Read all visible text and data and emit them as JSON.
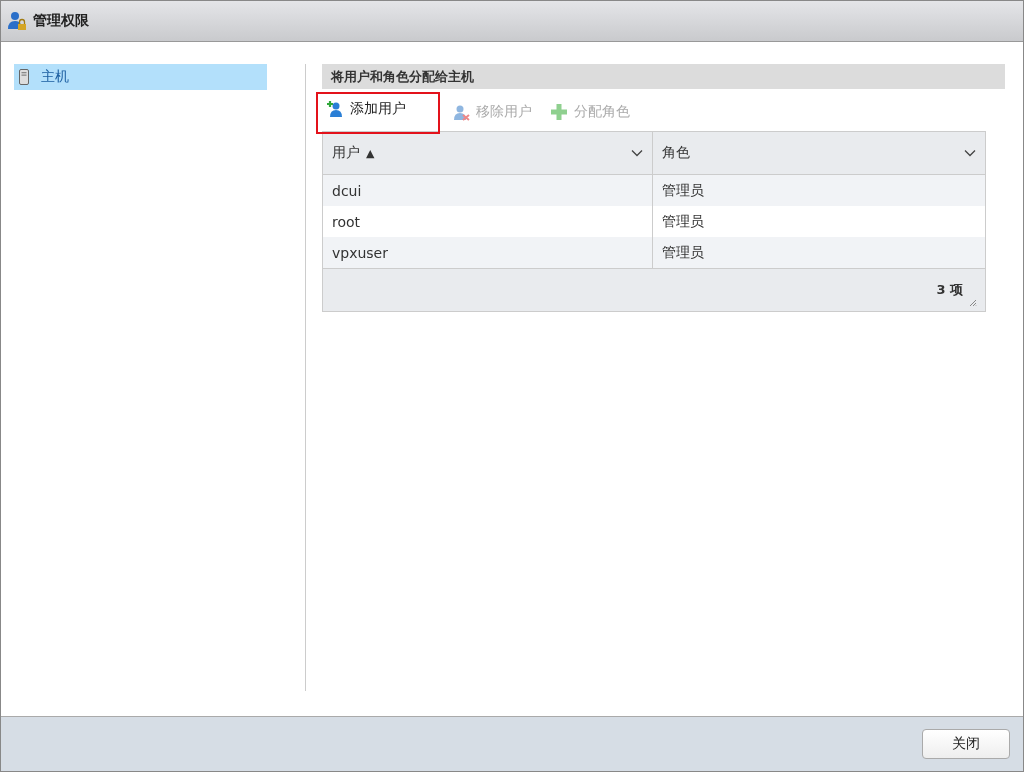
{
  "window": {
    "title": "管理权限"
  },
  "sidebar": {
    "items": [
      {
        "label": "主机",
        "selected": true
      }
    ]
  },
  "panel": {
    "title": "将用户和角色分配给主机",
    "toolbar": [
      {
        "label": "添加用户",
        "kind": "add-user",
        "disabled": false,
        "highlighted": true
      },
      {
        "label": "移除用户",
        "kind": "remove-user",
        "disabled": true,
        "highlighted": false
      },
      {
        "label": "分配角色",
        "kind": "assign-role",
        "disabled": true,
        "highlighted": false
      }
    ],
    "table": {
      "columns": [
        {
          "label": "用户",
          "sort_indicator": "▲"
        },
        {
          "label": "角色"
        }
      ],
      "rows": [
        {
          "cells": [
            "dcui",
            "管理员"
          ]
        },
        {
          "cells": [
            "root",
            "管理员"
          ]
        },
        {
          "cells": [
            "vpxuser",
            "管理员"
          ]
        }
      ],
      "footer": "3 项"
    }
  },
  "buttons": [
    {
      "label": "关闭"
    }
  ]
}
